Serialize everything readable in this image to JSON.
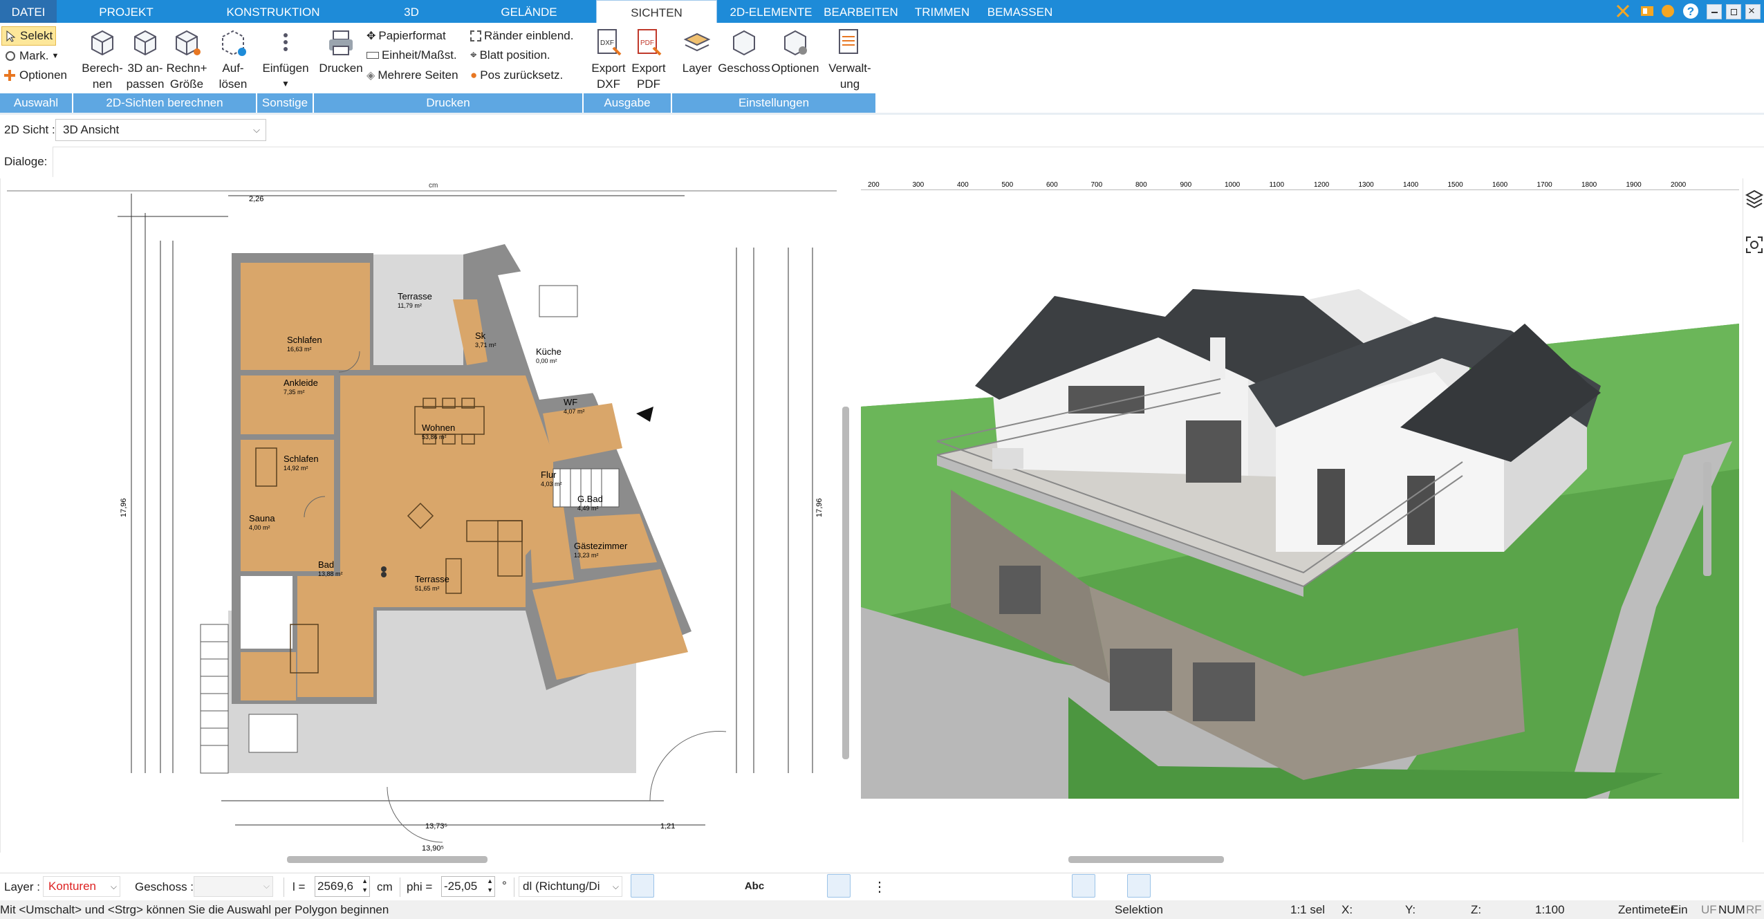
{
  "tabs": [
    {
      "label": "DATEI"
    },
    {
      "label": "PROJEKT"
    },
    {
      "label": "KONSTRUKTION"
    },
    {
      "label": "3D"
    },
    {
      "label": "GELÄNDE"
    },
    {
      "label": "SICHTEN"
    },
    {
      "label": "2D-ELEMENTE"
    },
    {
      "label": "BEARBEITEN"
    },
    {
      "label": "TRIMMEN"
    },
    {
      "label": "BEMASSEN"
    }
  ],
  "ribbon": {
    "auswahl": {
      "selekt": "Selekt",
      "mark": "Mark.",
      "optionen": "Optionen",
      "group": "Auswahl"
    },
    "sichten2d": {
      "berechnen_1": "Berech-",
      "berechnen_2": "nen",
      "anpassen_1": "3D an-",
      "anpassen_2": "passen",
      "rechn_1": "Rechn+",
      "rechn_2": "Größe",
      "aufloesen_1": "Auf-",
      "aufloesen_2": "lösen",
      "group": "2D-Sichten berechnen"
    },
    "sonstige": {
      "einfuegen": "Einfügen",
      "group": "Sonstige"
    },
    "drucken": {
      "drucken": "Drucken",
      "papierformat": "Papierformat",
      "einheit": "Einheit/Maßst.",
      "mehrere": "Mehrere Seiten",
      "raender": "Ränder einblend.",
      "blatt": "Blatt position.",
      "pos": "Pos zurücksetz.",
      "group": "Drucken"
    },
    "ausgabe": {
      "dxf_1": "Export",
      "dxf_2": "DXF",
      "pdf_1": "Export",
      "pdf_2": "PDF",
      "group": "Ausgabe"
    },
    "einstellungen": {
      "layer": "Layer",
      "geschoss": "Geschoss",
      "optionen": "Optionen",
      "verwaltung_1": "Verwalt-",
      "verwaltung_2": "ung",
      "group": "Einstellungen"
    }
  },
  "sicht2d": {
    "label": "2D Sicht :",
    "value": "3D Ansicht"
  },
  "dialoge": {
    "label": "Dialoge:"
  },
  "plan": {
    "ruler_unit": "cm",
    "rooms": [
      {
        "name": "Terrasse",
        "area": "11,79 m²"
      },
      {
        "name": "Schlafen",
        "area": "16,63 m²"
      },
      {
        "name": "Sk",
        "area": "3,71 m²"
      },
      {
        "name": "Küche",
        "area": "0,00 m²"
      },
      {
        "name": "Ankleide",
        "area": "7,35 m²"
      },
      {
        "name": "WF",
        "area": "4,07 m²"
      },
      {
        "name": "Wohnen",
        "area": "53,86 m²"
      },
      {
        "name": "Schlafen",
        "area": "14,92 m²"
      },
      {
        "name": "G.Bad",
        "area": "4,49 m²"
      },
      {
        "name": "Flur",
        "area": "4,03 m²"
      },
      {
        "name": "Sauna",
        "area": "4,00 m²"
      },
      {
        "name": "Gästezimmer",
        "area": "13,23 m²"
      },
      {
        "name": "Bad",
        "area": "13,88 m²"
      },
      {
        "name": "Terrasse",
        "area": "51,65 m²"
      }
    ],
    "dims": {
      "left_total": "17,96",
      "right_total": "17,96",
      "bottom_1": "13,73⁵",
      "bottom_2": "13,90⁵",
      "top_1": "2,26",
      "bottom_small": "1,21"
    }
  },
  "view3d": {
    "ruler_ticks": [
      "200",
      "300",
      "400",
      "500",
      "600",
      "700",
      "800",
      "900",
      "1000",
      "1100",
      "1200",
      "1300",
      "1400",
      "1500",
      "1600",
      "1700",
      "1800",
      "1900",
      "2000"
    ]
  },
  "bottombar": {
    "layer_label": "Layer :",
    "layer_value": "Konturen",
    "geschoss_label": "Geschoss :",
    "geschoss_value": "",
    "l_label": "l =",
    "l_value": "2569,6",
    "l_unit": "cm",
    "phi_label": "phi =",
    "phi_value": "-25,05",
    "phi_unit": "°",
    "dl_value": "dl (Richtung/Di",
    "abc": "Abc"
  },
  "status": {
    "hint": "Mit <Umschalt> und <Strg> können Sie die Auswahl per Polygon beginnen",
    "mode": "Selektion",
    "sel": "1:1 sel",
    "x": "X:",
    "y": "Y:",
    "z": "Z:",
    "scale": "1:100",
    "unit": "Zentimeter",
    "ein": "Ein",
    "uf": "UF",
    "num": "NUM",
    "rf": "RF"
  },
  "colors": {
    "accent": "#1e8bd8",
    "group": "#5ea7e2",
    "wood": "#d9a66a",
    "wall": "#8c8c8c",
    "grass": "#5aa44a",
    "roof": "#3c3f42"
  }
}
